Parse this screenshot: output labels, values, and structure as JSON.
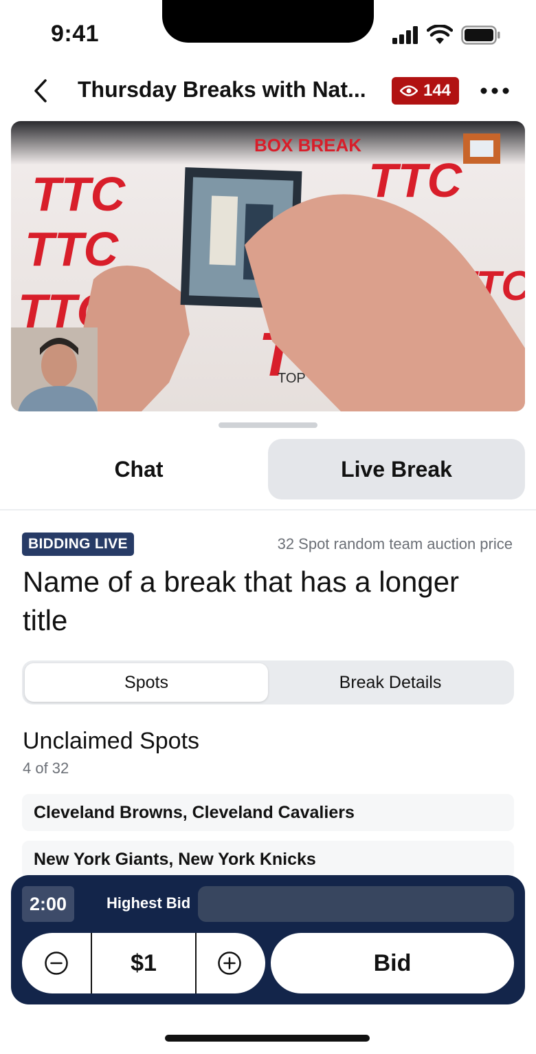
{
  "status_bar": {
    "time": "9:41"
  },
  "nav": {
    "title": "Thursday Breaks with Nat...",
    "viewer_count": "144",
    "back_icon": "chevron-left-icon",
    "more_icon": "ellipsis-icon"
  },
  "video": {
    "banner_text": "BOX BREAK",
    "brand_text": "TTC",
    "brand_tagline": "TOP TRADING CARDS"
  },
  "tabs": [
    {
      "label": "Chat",
      "selected": false
    },
    {
      "label": "Live Break",
      "selected": true
    }
  ],
  "break": {
    "status_badge": "BIDDING LIVE",
    "subtitle": "32 Spot random team auction price",
    "title": "Name of a break that has a longer title"
  },
  "segments": [
    {
      "label": "Spots",
      "selected": true
    },
    {
      "label": "Break Details",
      "selected": false
    }
  ],
  "spots": {
    "heading": "Unclaimed Spots",
    "count": "4 of 32",
    "items": [
      "Cleveland Browns, Cleveland Cavaliers",
      "New York Giants, New York Knicks"
    ]
  },
  "bid_panel": {
    "timer": "2:00",
    "highest_bid_label": "Highest Bid",
    "highest_bid_value": "",
    "amount": "$1",
    "bid_label": "Bid"
  },
  "colors": {
    "viewer_badge": "#b11212",
    "status_badge": "#273b66",
    "bid_panel": "#13254a",
    "brand_red": "#d81e2a"
  }
}
